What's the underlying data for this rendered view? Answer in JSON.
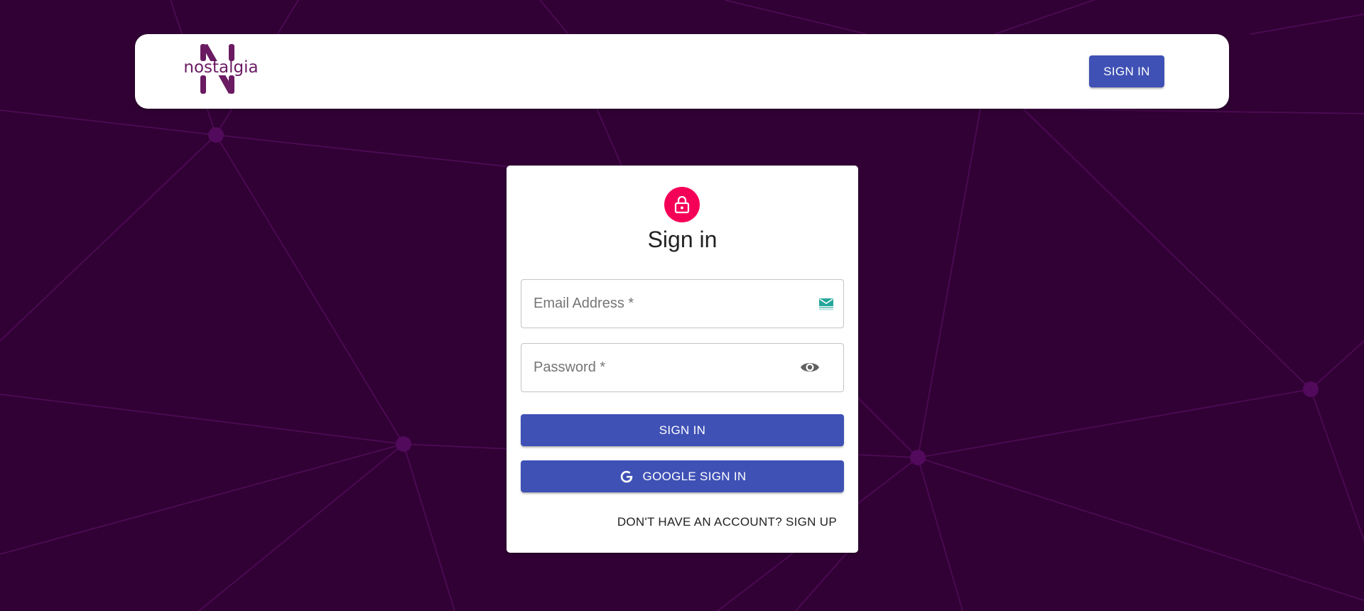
{
  "background": {
    "color": "#310034",
    "line_color": "#4a0a52",
    "node_color": "#520a5c"
  },
  "header": {
    "logo_text": "nostalgia",
    "logo_color": "#6a1b62",
    "signin_label": "SIGN IN"
  },
  "form": {
    "title": "Sign in",
    "lock_icon": "lock-icon",
    "email": {
      "placeholder": "Email Address *",
      "value": "",
      "icon": "email-icon"
    },
    "password": {
      "placeholder": "Password *",
      "value": "",
      "icon": "eye-icon"
    },
    "signin_button_label": "SIGN IN",
    "google_button_label": "GOOGLE SIGN IN",
    "google_icon": "google-icon",
    "signup_link_label": "DON'T HAVE AN ACCOUNT? SIGN UP"
  },
  "colors": {
    "primary": "#3f51b5",
    "accent": "#f50057"
  }
}
